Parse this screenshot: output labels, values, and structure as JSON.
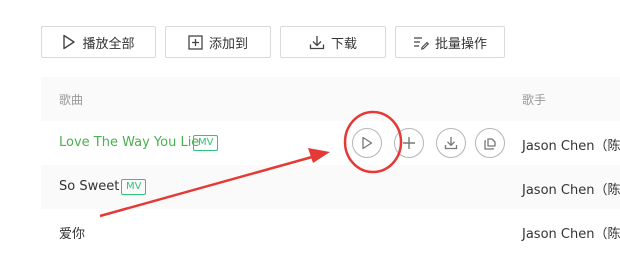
{
  "toolbar": {
    "play_all_label": "播放全部",
    "add_to_label": "添加到",
    "download_label": "下载",
    "batch_label": "批量操作"
  },
  "list": {
    "header": {
      "song_label": "歌曲",
      "artist_label": "歌手"
    },
    "rows": [
      {
        "title": "Love The Way You Lie",
        "mv": "MV",
        "artist": "Jason Chen（陈",
        "playing": true
      },
      {
        "title": "So Sweet",
        "mv": "MV",
        "artist": "Jason Chen（陈"
      },
      {
        "title": "爱你",
        "artist": "Jason Chen（陈"
      }
    ]
  },
  "row_actions": [
    "play-icon",
    "plus-icon",
    "download-icon",
    "share-icon"
  ],
  "annotation": {
    "color": "#e53935"
  },
  "colors": {
    "playing_title": "#4caf50",
    "mv_badge": "#31c27c"
  }
}
